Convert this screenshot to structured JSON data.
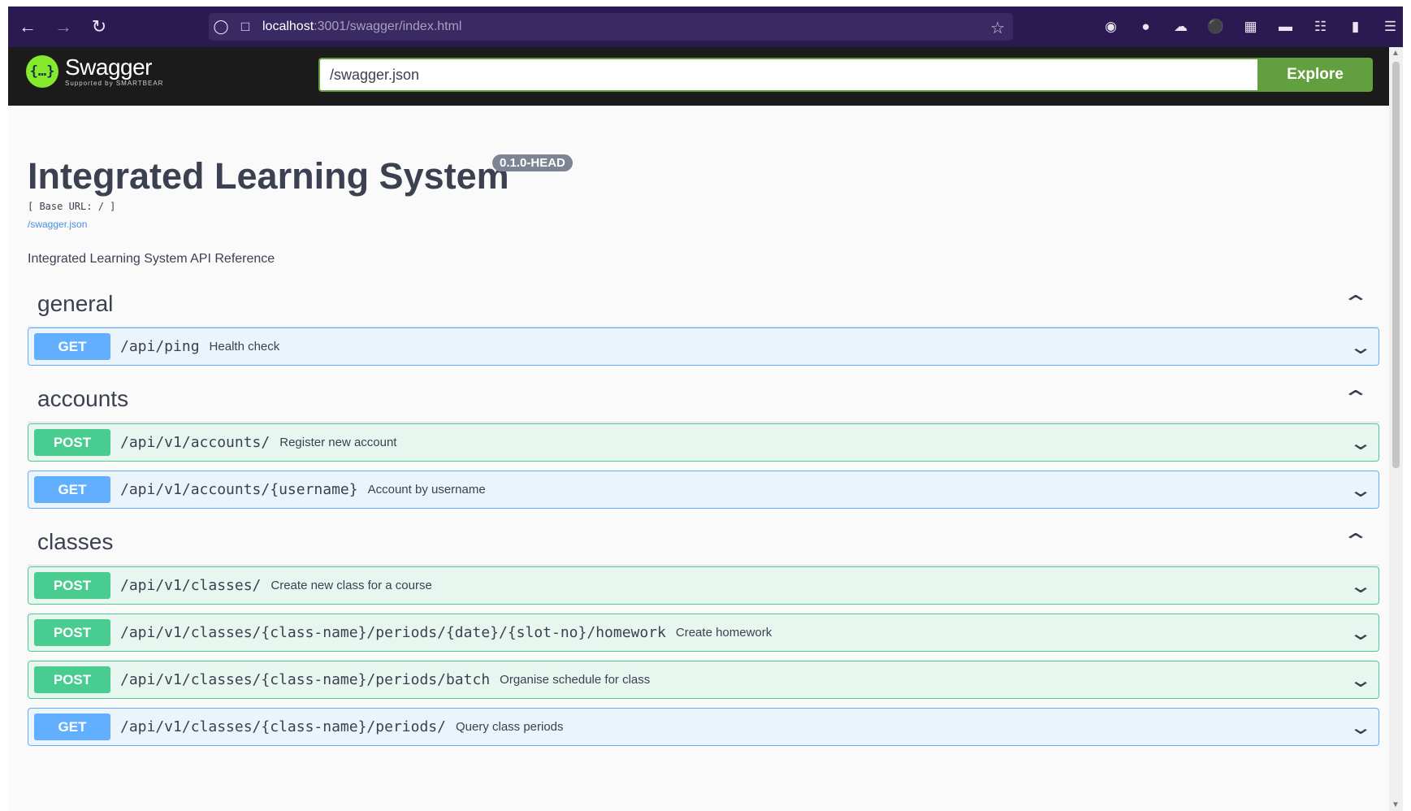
{
  "browser": {
    "url_host": "localhost",
    "url_path": ":3001/swagger/index.html",
    "back_icon": "arrow-left-icon",
    "forward_icon": "arrow-right-icon",
    "reload_icon": "reload-icon"
  },
  "topbar": {
    "logo_name": "Swagger",
    "logo_sub": "Supported by SMARTBEAR",
    "spec_url": "/swagger.json",
    "explore_label": "Explore"
  },
  "info": {
    "title": "Integrated Learning System",
    "version": "0.1.0-HEAD",
    "base_url": "[ Base URL: / ]",
    "spec_link": "/swagger.json",
    "description": "Integrated Learning System API Reference"
  },
  "tags": [
    {
      "name": "general",
      "operations": [
        {
          "method": "GET",
          "path": "/api/ping",
          "summary": "Health check"
        }
      ]
    },
    {
      "name": "accounts",
      "operations": [
        {
          "method": "POST",
          "path": "/api/v1/accounts/",
          "summary": "Register new account"
        },
        {
          "method": "GET",
          "path": "/api/v1/accounts/{username}",
          "summary": "Account by username"
        }
      ]
    },
    {
      "name": "classes",
      "operations": [
        {
          "method": "POST",
          "path": "/api/v1/classes/",
          "summary": "Create new class for a course"
        },
        {
          "method": "POST",
          "path": "/api/v1/classes/{class-name}/periods/{date}/{slot-no}/homework",
          "summary": "Create homework"
        },
        {
          "method": "POST",
          "path": "/api/v1/classes/{class-name}/periods/batch",
          "summary": "Organise schedule for class"
        },
        {
          "method": "GET",
          "path": "/api/v1/classes/{class-name}/periods/",
          "summary": "Query class periods"
        }
      ]
    }
  ],
  "colors": {
    "get": "#61affe",
    "post": "#49cc90",
    "explore": "#62a03f"
  }
}
